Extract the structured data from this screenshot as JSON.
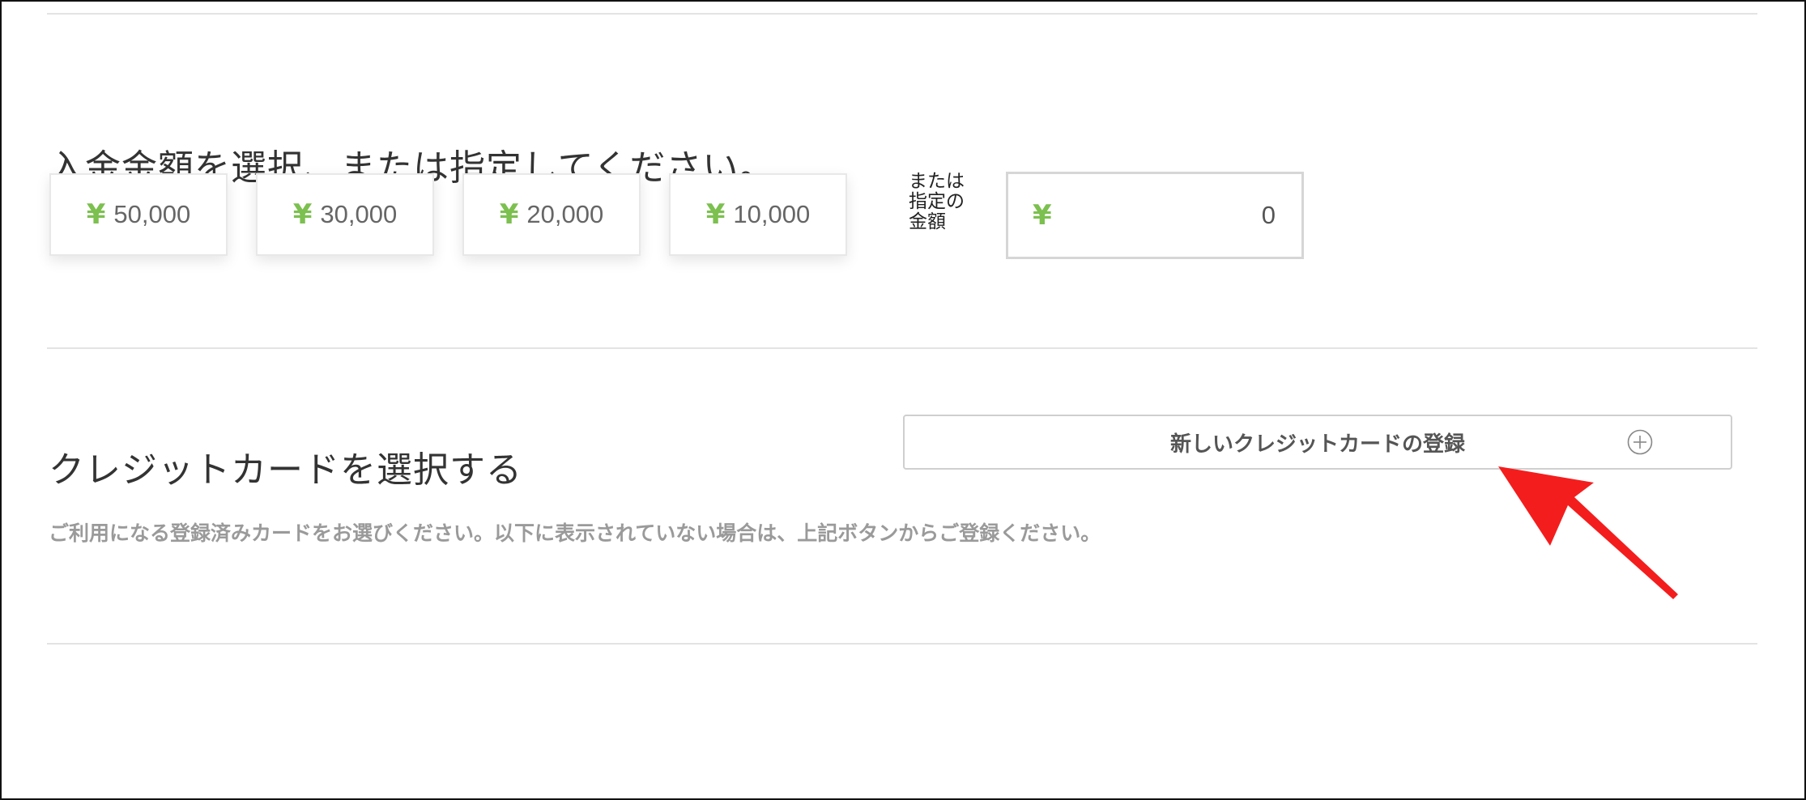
{
  "deposit": {
    "title": "入金金額を選択、または指定してください。",
    "currency_symbol": "¥",
    "presets": [
      "50,000",
      "30,000",
      "20,000",
      "10,000"
    ],
    "or_label_lines": [
      "または",
      "指定の",
      "金額"
    ],
    "custom_value": "0"
  },
  "card": {
    "title": "クレジットカードを選択する",
    "register_button_label": "新しいクレジットカードの登録",
    "helper_text": "ご利用になる登録済みカードをお選びください。以下に表示されていない場合は、上記ボタンからご登録ください。"
  },
  "colors": {
    "yen_green": "#7cc04f",
    "annotation_red": "#f41d1d"
  },
  "icons": {
    "register": "plus-circle-icon",
    "annotation": "arrow-icon"
  }
}
